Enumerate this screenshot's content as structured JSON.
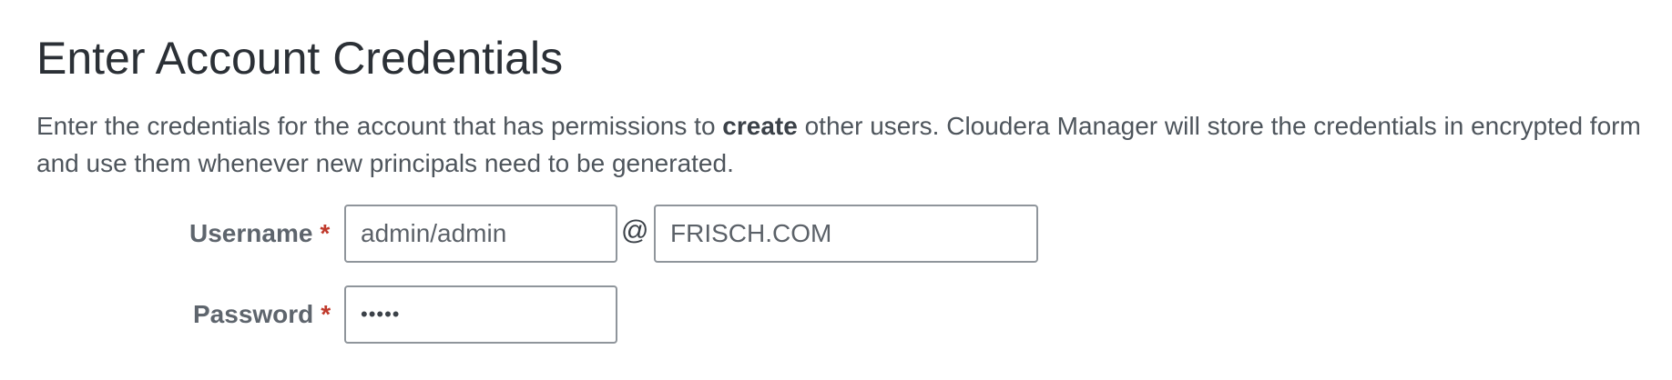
{
  "page": {
    "title": "Enter Account Credentials",
    "description_before": "Enter the credentials for the account that has permissions to ",
    "description_bold": "create",
    "description_after_line1": " other users. Cloudera Manager will store the credentials in encrypted form",
    "description_line2": "and use them whenever new principals need to be generated."
  },
  "form": {
    "username": {
      "label": "Username",
      "required_mark": "*",
      "value": "admin/admin",
      "at_symbol": "@",
      "realm_value": "FRISCH.COM"
    },
    "password": {
      "label": "Password",
      "required_mark": "*",
      "value": "•••••"
    }
  },
  "colors": {
    "required": "#c0392b",
    "input_border": "#8f959b"
  }
}
